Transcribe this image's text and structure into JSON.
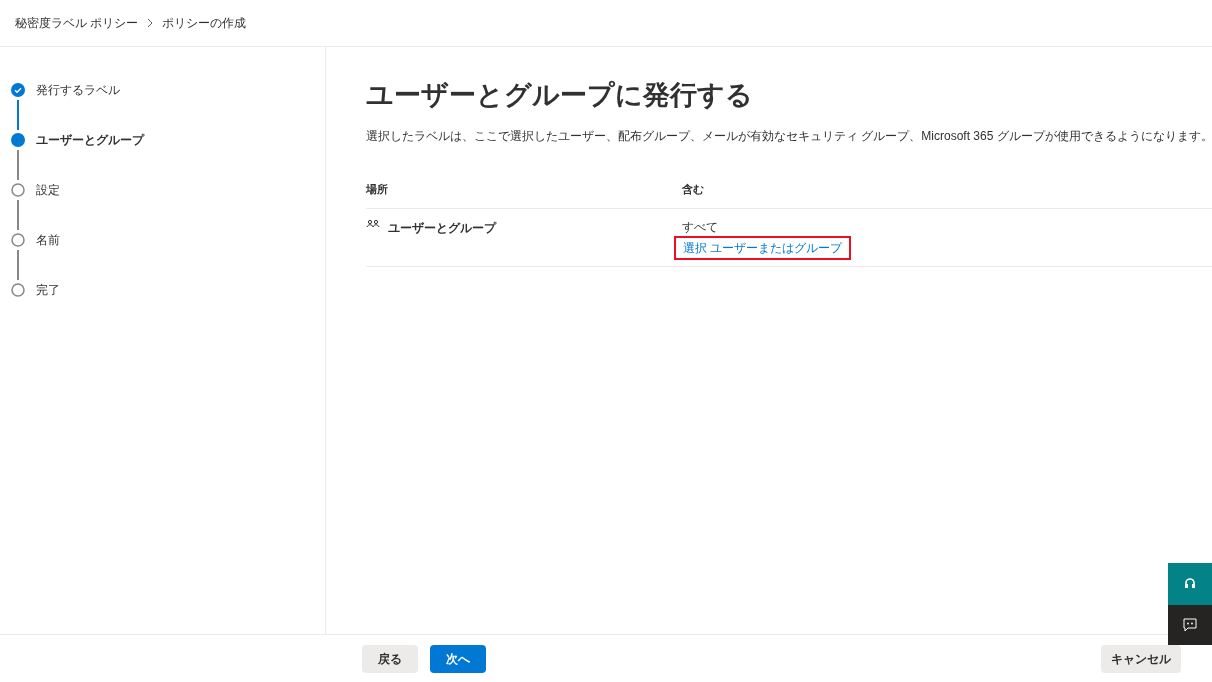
{
  "breadcrumb": [
    "秘密度ラベル ポリシー",
    "ポリシーの作成"
  ],
  "steps": [
    {
      "label": "発行するラベル",
      "kind": "done"
    },
    {
      "label": "ユーザーとグループ",
      "kind": "current"
    },
    {
      "label": "設定",
      "kind": "pending"
    },
    {
      "label": "名前",
      "kind": "pending"
    },
    {
      "label": "完了",
      "kind": "pending"
    }
  ],
  "title": "ユーザーとグループに発行する",
  "description": "選択したラベルは、ここで選択したユーザー、配布グループ、メールが有効なセキュリティ グループ、Microsoft 365 グループが使用できるようになります。",
  "table": {
    "columns": [
      "場所",
      "含む"
    ],
    "rows": [
      {
        "location": "ユーザーとグループ",
        "include": "すべて",
        "link": "選択 ユーザーまたはグループ",
        "highlighted": true
      }
    ]
  },
  "footer": {
    "back": "戻る",
    "next": "次へ",
    "cancel": "キャンセル"
  }
}
